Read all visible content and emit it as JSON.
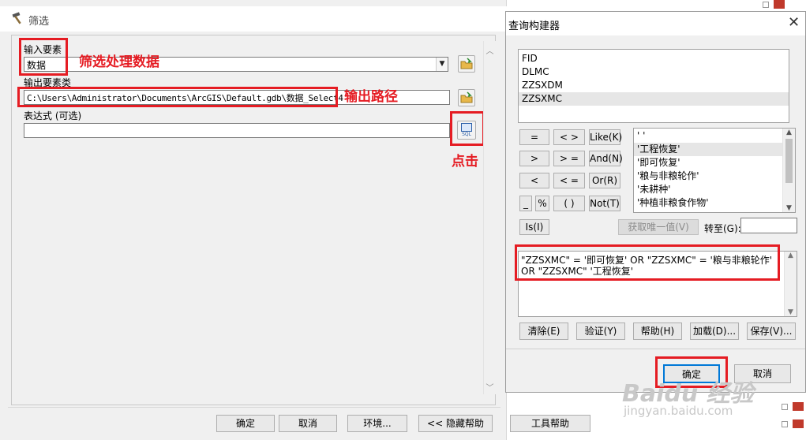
{
  "main": {
    "title": "筛选",
    "input_label": "输入要素",
    "input_value": "数据",
    "output_label": "输出要素类",
    "output_value": "C:\\Users\\Administrator\\Documents\\ArcGIS\\Default.gdb\\数据_Select4",
    "expr_label": "表达式 (可选)",
    "expr_value": "",
    "sql_icon_text": "SQL"
  },
  "annotations": {
    "input": "筛选处理数据",
    "output": "输出路径",
    "sql": "点击"
  },
  "bottom_buttons": {
    "ok": "确定",
    "cancel": "取消",
    "env": "环境...",
    "hide_help": "<< 隐藏帮助",
    "tool_help": "工具帮助"
  },
  "query_builder": {
    "title": "查询构建器",
    "close": "✕",
    "fields": [
      "FID",
      "DLMC",
      "ZZSXDM",
      "ZZSXMC"
    ],
    "operators": {
      "eq": "=",
      "ne": "< >",
      "like": "Like(K)",
      "gt": ">",
      "ge": "> =",
      "and": "And(N)",
      "lt": "<",
      "le": "< =",
      "or": "Or(R)",
      "underscore": "_",
      "percent": "%",
      "parens": "( )",
      "not": "Not(T)",
      "is": "Is(I)"
    },
    "values": [
      "' '",
      "'工程恢复'",
      "'即可恢复'",
      "'粮与非粮轮作'",
      "'未耕种'",
      "'种植非粮食作物'"
    ],
    "get_unique": "获取唯一值(V)",
    "goto_label": "转至(G):",
    "goto_value": "",
    "sql_expression": "\"ZZSXMC\" = '即可恢复' OR \"ZZSXMC\" = '粮与非粮轮作' OR \"ZZSXMC\" '工程恢复'",
    "buttons": {
      "clear": "清除(E)",
      "verify": "验证(Y)",
      "help": "帮助(H)",
      "load": "加载(D)...",
      "save": "保存(V)..."
    },
    "ok": "确定",
    "cancel": "取消"
  },
  "watermark": {
    "brand": "Baidu 经验",
    "url": "jingyan.baidu.com"
  },
  "colors": {
    "annotation_red": "#e51c23",
    "window_bg": "#f0f0f0",
    "accent_blue": "#0078d7"
  }
}
